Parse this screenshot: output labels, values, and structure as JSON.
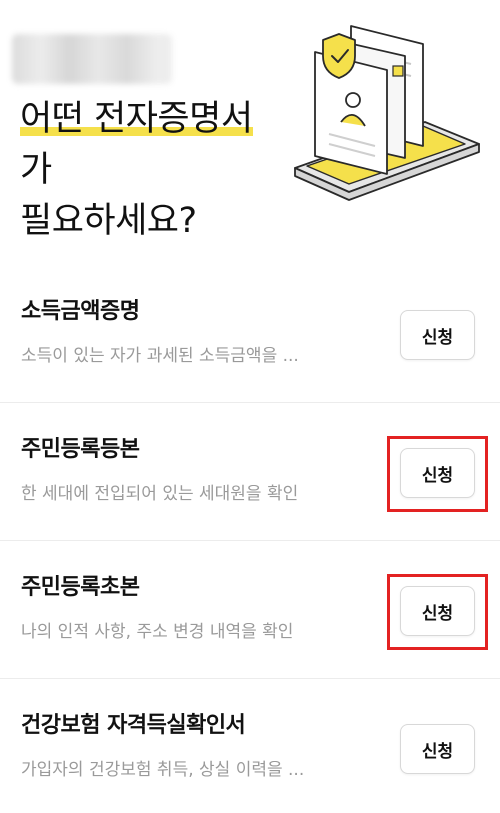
{
  "header": {
    "title_highlight": "어떤 전자증명서",
    "title_line2": "가",
    "title_line3": "필요하세요?"
  },
  "items": [
    {
      "title": "소득금액증명",
      "desc": "소득이 있는 자가 과세된 소득금액을 ...",
      "button": "신청",
      "marked": false
    },
    {
      "title": "주민등록등본",
      "desc": "한 세대에 전입되어 있는 세대원을 확인",
      "button": "신청",
      "marked": true
    },
    {
      "title": "주민등록초본",
      "desc": "나의 인적 사항, 주소 변경 내역을 확인",
      "button": "신청",
      "marked": true
    },
    {
      "title": "건강보험 자격득실확인서",
      "desc": "가입자의 건강보험 취득, 상실 이력을 ...",
      "button": "신청",
      "marked": false
    }
  ],
  "colors": {
    "accent": "#f5e04b",
    "marker": "#e32222",
    "muted_text": "#9a9a9a"
  },
  "icons": [
    "document-stack-illustration",
    "person-icon",
    "shield-badge-icon"
  ]
}
